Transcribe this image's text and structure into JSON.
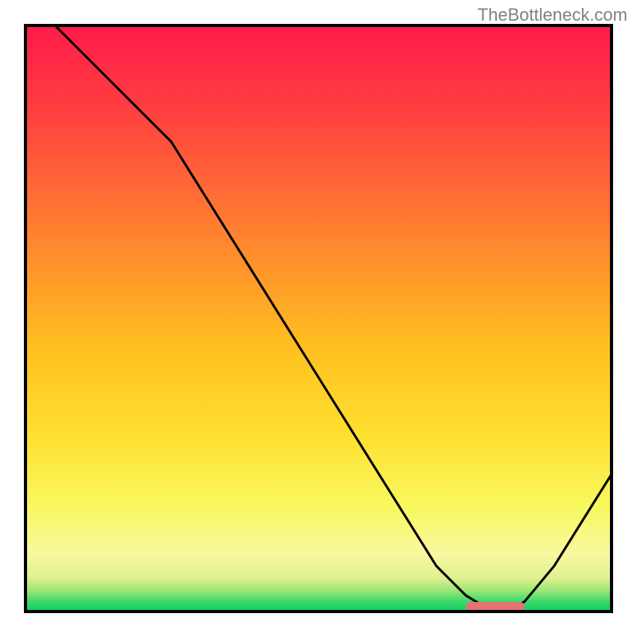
{
  "watermark": "TheBottleneck.com",
  "chart_data": {
    "type": "line",
    "title": "",
    "xlabel": "",
    "ylabel": "",
    "xlim": [
      0,
      100
    ],
    "ylim": [
      0,
      100
    ],
    "x": [
      0,
      5,
      10,
      15,
      20,
      25,
      30,
      35,
      40,
      45,
      50,
      55,
      60,
      65,
      70,
      75,
      80,
      82,
      85,
      90,
      95,
      100
    ],
    "values": [
      105,
      100,
      95,
      90,
      85,
      80,
      72,
      64,
      56,
      48,
      40,
      32,
      24,
      16,
      8,
      3,
      0,
      0,
      2,
      8,
      16,
      24
    ],
    "optimum_range": {
      "x_start": 75,
      "x_end": 85
    },
    "gradient_colors": {
      "top": "#ff1a4a",
      "upper": "#ff6040",
      "middle": "#ffb030",
      "lower": "#ffe030",
      "lower2": "#f8f878",
      "bottom": "#00d060"
    },
    "marker_color": "#e57373"
  }
}
